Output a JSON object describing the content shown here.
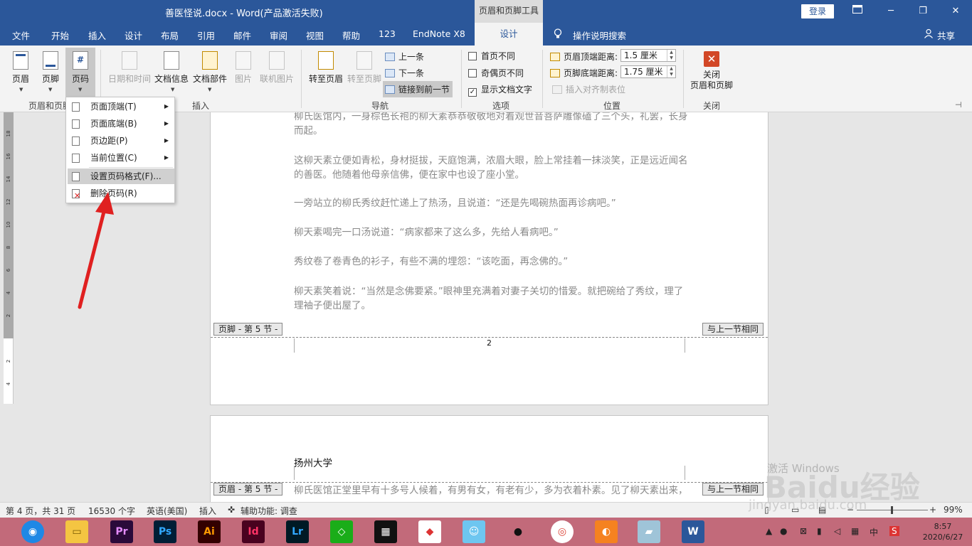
{
  "titlebar": {
    "doc_title": "善医怪说.docx  -  Word(产品激活失败)",
    "tools_tab": "页眉和页脚工具",
    "login": "登录",
    "ribbon_display_icon": "ribbon-display-icon",
    "minimize": "─",
    "restore": "❐",
    "close": "✕"
  },
  "tabs": {
    "file": "文件",
    "home": "开始",
    "insert": "插入",
    "design_doc": "设计",
    "layout": "布局",
    "references": "引用",
    "mailings": "邮件",
    "review": "审阅",
    "view": "视图",
    "help": "帮助",
    "n123": "123",
    "endnote": "EndNote X8",
    "design": "设计",
    "tell_me": "操作说明搜索",
    "share": "共享"
  },
  "ribbon": {
    "header": "页眉",
    "footer": "页脚",
    "page_number": "页码",
    "group_hf": "页眉和页脚",
    "date_time": "日期和时间",
    "doc_info": "文档信息",
    "doc_parts": "文档部件",
    "picture": "图片",
    "online_picture": "联机图片",
    "group_insert": "插入",
    "goto_header": "转至页眉",
    "goto_footer": "转至页脚",
    "prev": "上一条",
    "next": "下一条",
    "link_prev": "链接到前一节",
    "group_nav": "导航",
    "diff_first": "首页不同",
    "diff_odd_even": "奇偶页不同",
    "show_doc_text": "显示文档文字",
    "group_options": "选项",
    "header_top_label": "页眉顶端距离:",
    "header_top_value": "1.5 厘米",
    "footer_bottom_label": "页脚底端距离:",
    "footer_bottom_value": "1.75 厘米",
    "insert_align_tab": "插入对齐制表位",
    "group_position": "位置",
    "close_hf_line1": "关闭",
    "close_hf_line2": "页眉和页脚",
    "group_close": "关闭"
  },
  "dropdown": {
    "items": [
      {
        "label": "页面顶端(T)",
        "submenu": true
      },
      {
        "label": "页面底端(B)",
        "submenu": true
      },
      {
        "label": "页边距(P)",
        "submenu": true
      },
      {
        "label": "当前位置(C)",
        "submenu": true
      },
      {
        "label": "设置页码格式(F)...",
        "submenu": false
      },
      {
        "label": "删除页码(R)",
        "submenu": false
      }
    ]
  },
  "ruler": [
    "18",
    "16",
    "14",
    "12",
    "10",
    "8",
    "6",
    "4",
    "2",
    "2",
    "4"
  ],
  "document": {
    "paragraphs": [
      "柳氏医馆内，一身棕色长袍的柳大素恭恭敬敬地对着观世音菩萨雕像磕了三个头，礼罢，长身而起。",
      "这柳天素立便如青松，身材挺拔，天庭饱满，浓眉大眼，脸上常挂着一抹淡笑，正是远近闻名的善医。他随着他母亲信佛，便在家中也设了座小堂。",
      "一旁站立的柳氏秀纹赶忙递上了热汤，且说道：“还是先喝碗热面再诊病吧。”",
      "柳天素喝完一口汤说道：“病家都来了这么多，先给人看病吧。”",
      "秀纹卷了卷青色的衫子，有些不满的埋怨：“该吃面，再念佛的。”",
      "柳天素笑着说：“当然是念佛要紧。”眼神里充满着对妻子关切的惜爱。就把碗给了秀纹，理了理袖子便出屋了。"
    ],
    "footer_tag": "页脚 - 第 5 节 -",
    "same_as_prev": "与上一节相同",
    "page_number": "2",
    "header_text": "扬州大学",
    "header_tag": "页眉 - 第 5 节 -",
    "page2_para": "柳氏医馆正堂里早有十多号人候着，有男有女，有老有少，多为衣着朴素。见了柳天素出来，"
  },
  "statusbar": {
    "page": "第 4 页，共 31 页",
    "words": "16530 个字",
    "lang": "英语(美国)",
    "insert_mode": "插入",
    "accessibility": "辅助功能: 调查",
    "zoom": "99%",
    "minus": "−",
    "plus": "+"
  },
  "taskbar": {
    "apps": [
      {
        "name": "Pr",
        "color": "#2a0a3a",
        "fg": "#e58cff"
      },
      {
        "name": "Ps",
        "color": "#001e36",
        "fg": "#31a8ff"
      },
      {
        "name": "Ai",
        "color": "#330000",
        "fg": "#ff9a00"
      },
      {
        "name": "Id",
        "color": "#49021f",
        "fg": "#ff3366"
      },
      {
        "name": "Lr",
        "color": "#001a25",
        "fg": "#31a8ff"
      }
    ],
    "tray_lang": "中",
    "time": "8:57",
    "date": "2020/6/27"
  },
  "watermark": {
    "brand": "Baidu经验",
    "url": "jingyan.baidu.com",
    "activate": "激活 Windows"
  },
  "colors": {
    "word_blue": "#2b579a",
    "taskbar": "#c26a7a",
    "arrow_red": "#e02020"
  }
}
